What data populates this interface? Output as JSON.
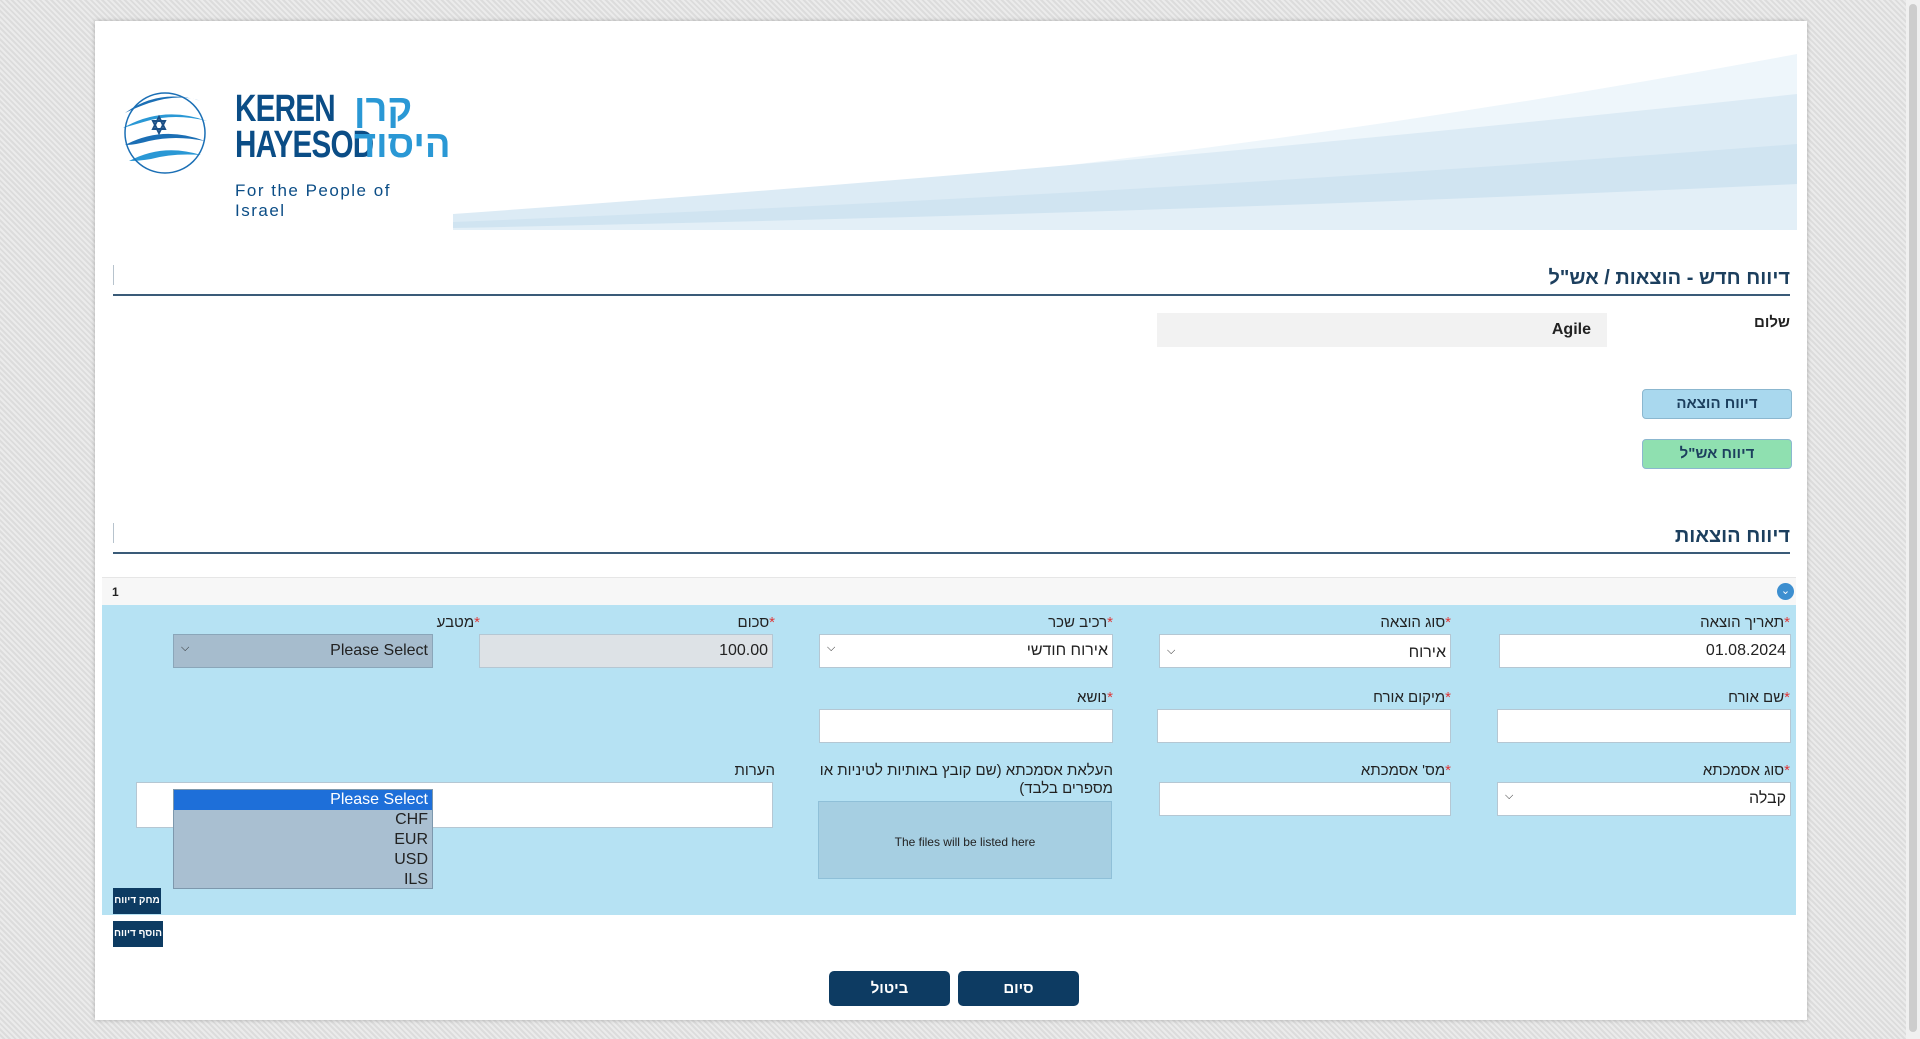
{
  "logo": {
    "en_text": "KEREN\nHAYESOD",
    "he_text": "קרן\nהיסוד",
    "tagline": "For the People of Israel"
  },
  "header": {
    "title": "דיווח חדש - הוצאות / אש\"ל"
  },
  "name_field": {
    "label": "שלום",
    "value": "Agile"
  },
  "report_types": {
    "expense_label": "דיווח הוצאה",
    "perdiem_label": "דיווח אש\"ל"
  },
  "expenses_section": {
    "title": "דיווח הוצאות"
  },
  "report_item": {
    "index": "1",
    "fields": {
      "expense_date": {
        "label": "תאריך הוצאה",
        "value": "01.08.2024"
      },
      "expense_type": {
        "label": "סוג הוצאה",
        "value": "אירוח"
      },
      "cost_component": {
        "label": "רכיב שכר",
        "value": "אירוח חודשי"
      },
      "amount": {
        "label": "סכום",
        "value": "100.00"
      },
      "currency": {
        "label": "מטבע",
        "value": "Please Select",
        "options": [
          "Please Select",
          "CHF",
          "EUR",
          "USD",
          "ILS"
        ]
      },
      "guest_name": {
        "label": "שם אורח",
        "value": ""
      },
      "guest_location": {
        "label": "מיקום אורח",
        "value": ""
      },
      "subject": {
        "label": "נושא",
        "value": ""
      },
      "reference_type": {
        "label": "סוג אסמכתא",
        "value": "קבלה"
      },
      "reference_number": {
        "label": "מס' אסמכתא",
        "value": ""
      },
      "upload": {
        "label": "העלאת אסמכתא (שם קובץ באותיות לטיניות או מספרים בלבד)",
        "placeholder": "The files will be listed here"
      },
      "notes": {
        "label": "הערות",
        "value": ""
      }
    },
    "required_mark": "*"
  },
  "item_buttons": {
    "delete_label": "מחק דיווח",
    "add_label": "הוסף דיווח"
  },
  "actions": {
    "finish_label": "סיום",
    "cancel_label": "ביטול"
  },
  "colors": {
    "primary": "#0d3b62",
    "panel": "#b6e2f3",
    "title": "#1c3f5e",
    "required": "#e03535"
  }
}
